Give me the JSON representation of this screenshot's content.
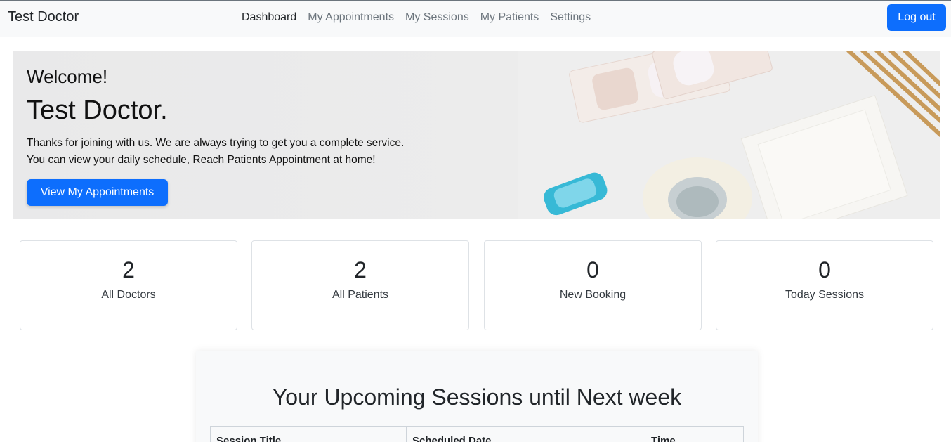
{
  "navbar": {
    "brand": "Test Doctor",
    "links": [
      "Dashboard",
      "My Appointments",
      "My Sessions",
      "My Patients",
      "Settings"
    ],
    "logout_label": "Log out"
  },
  "hero": {
    "welcome": "Welcome!",
    "name": "Test Doctor.",
    "line1": "Thanks for joining with us. We are always trying to get you a complete service.",
    "line2": "You can view your daily schedule, Reach Patients Appointment at home!",
    "button_label": "View My Appointments"
  },
  "stats": [
    {
      "value": "2",
      "label": "All Doctors"
    },
    {
      "value": "2",
      "label": "All Patients"
    },
    {
      "value": "0",
      "label": "New Booking"
    },
    {
      "value": "0",
      "label": "Today Sessions"
    }
  ],
  "sessions": {
    "title": "Your Upcoming Sessions until Next week",
    "columns": [
      "Session Title",
      "Scheduled Date",
      "Time"
    ]
  },
  "colors": {
    "primary": "#0d6efd",
    "navbar_bg": "#f8f9fa",
    "muted_text": "#6c757d"
  }
}
